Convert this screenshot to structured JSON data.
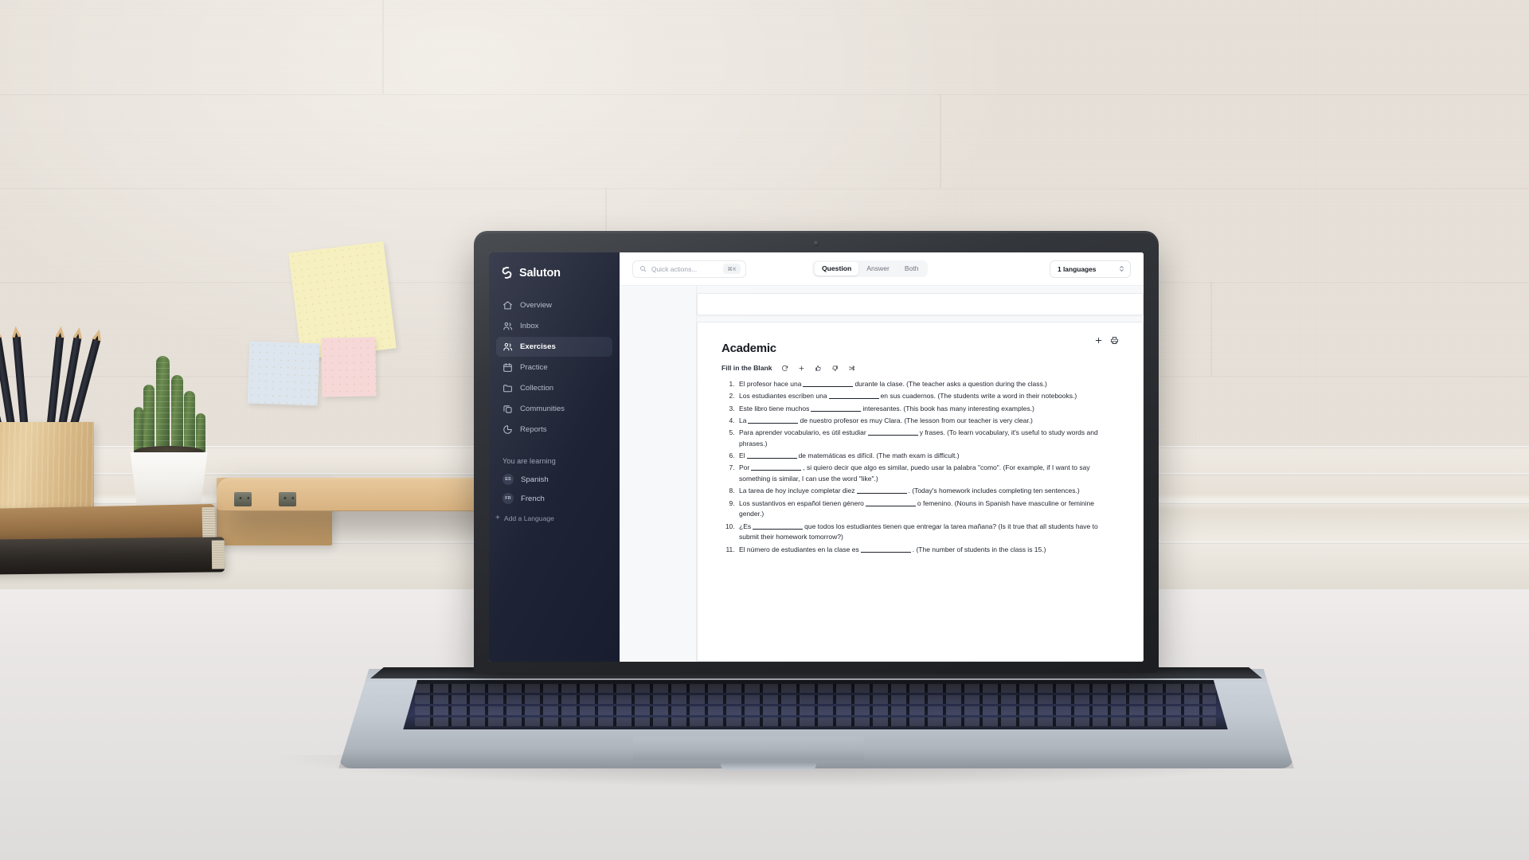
{
  "app": {
    "brand_name": "Saluton",
    "brand_icon": "saluton-swirl-logo"
  },
  "sidebar": {
    "items": [
      {
        "label": "Overview",
        "icon": "home-icon",
        "active": false
      },
      {
        "label": "Inbox",
        "icon": "users-icon",
        "active": false
      },
      {
        "label": "Exercises",
        "icon": "users-icon",
        "active": true
      },
      {
        "label": "Practice",
        "icon": "calendar-icon",
        "active": false
      },
      {
        "label": "Collection",
        "icon": "folder-icon",
        "active": false
      },
      {
        "label": "Communities",
        "icon": "copy-icon",
        "active": false
      },
      {
        "label": "Reports",
        "icon": "pie-chart-icon",
        "active": false
      }
    ],
    "learning_header": "You are learning",
    "languages": [
      {
        "code": "ES",
        "label": "Spanish"
      },
      {
        "code": "FR",
        "label": "French"
      }
    ],
    "add_language_label": "Add a Language",
    "add_language_icon": "plus-icon",
    "background_color": "#151a2d",
    "active_item_color": "#23293d"
  },
  "topbar": {
    "search": {
      "placeholder": "Quick actions...",
      "value": "",
      "icon": "search-icon",
      "shortcut": "⌘K"
    },
    "segmented": {
      "options": [
        "Question",
        "Answer",
        "Both"
      ],
      "selected": "Question"
    },
    "language_select": {
      "value": "1 languages",
      "icon": "chevron-updown-icon"
    }
  },
  "card": {
    "title": "Academic",
    "header_actions": [
      {
        "name": "add-icon",
        "glyph": "+"
      },
      {
        "name": "print-icon",
        "glyph": "print"
      }
    ],
    "exercise_type": "Fill in the Blank",
    "type_actions": [
      {
        "name": "refresh-icon"
      },
      {
        "name": "plus-icon"
      },
      {
        "name": "thumbs-up-icon"
      },
      {
        "name": "thumbs-down-icon"
      },
      {
        "name": "shuffle-icon"
      }
    ],
    "questions": [
      {
        "n": 1,
        "pre": "El profesor hace una",
        "post": "durante la clase. (The teacher asks a question during the class.)"
      },
      {
        "n": 2,
        "pre": "Los estudiantes escriben una",
        "post": "en sus cuadernos. (The students write a word in their notebooks.)"
      },
      {
        "n": 3,
        "pre": "Este libro tiene muchos",
        "post": "interesantes. (This book has many interesting examples.)"
      },
      {
        "n": 4,
        "pre": "La",
        "post": "de nuestro profesor es muy Clara. (The lesson from our teacher is very clear.)"
      },
      {
        "n": 5,
        "pre": "Para aprender vocabulario, es útil estudiar",
        "post": "y frases. (To learn vocabulary, it's useful to study words and phrases.)"
      },
      {
        "n": 6,
        "pre": "El",
        "post": "de matemáticas es difícil. (The math exam is difficult.)"
      },
      {
        "n": 7,
        "pre": "Por",
        "post": ", si quiero decir que algo es similar, puedo usar la palabra \"como\". (For example, if I want to say something is similar, I can use the word \"like\".)"
      },
      {
        "n": 8,
        "pre": "La tarea de hoy incluye completar diez",
        "post": ". (Today's homework includes completing ten sentences.)"
      },
      {
        "n": 9,
        "pre": "Los sustantivos en español tienen género",
        "post": "o femenino. (Nouns in Spanish have masculine or feminine gender.)"
      },
      {
        "n": 10,
        "pre": "¿Es",
        "post": "que todos los estudiantes tienen que entregar la tarea mañana? (Is it true that all students have to submit their homework tomorrow?)"
      },
      {
        "n": 11,
        "pre": "El número de estudiantes en la clase es",
        "post": ". (The number of students in the class is 15.)"
      }
    ]
  },
  "scene": {
    "description": "laptop-on-desk-photo",
    "objects": [
      "brick-wall",
      "sticky-notes",
      "pencil-cup",
      "cactus-plant",
      "books",
      "wooden-box",
      "laptop"
    ]
  }
}
